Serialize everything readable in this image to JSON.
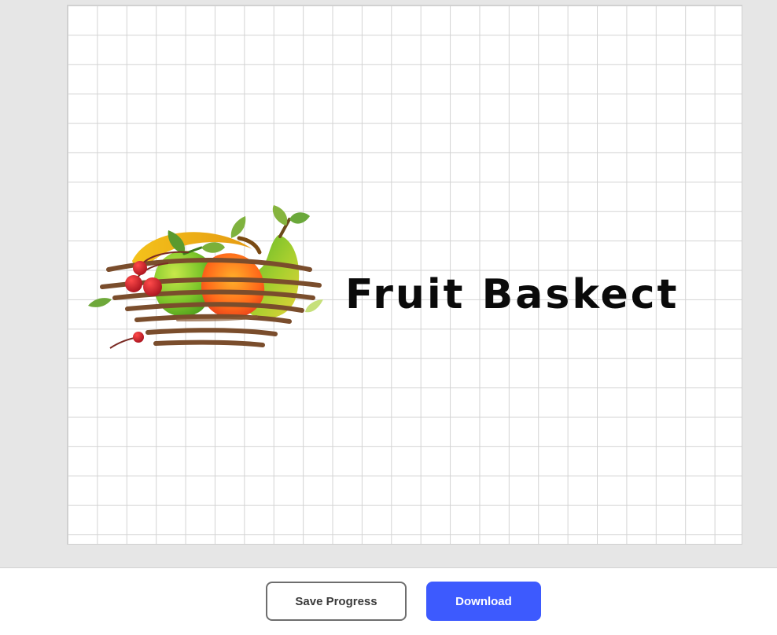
{
  "canvas": {
    "logo_text": "Fruit Baskect",
    "logo_icon": "fruit-basket-icon"
  },
  "actions": {
    "save_label": "Save Progress",
    "download_label": "Download"
  },
  "colors": {
    "workspace_background": "#e6e6e6",
    "grid_line": "#d3d3d3",
    "download_button": "#3d5afe",
    "save_button_border": "#6e6e6e",
    "logo_text": "#0a0a0a"
  }
}
